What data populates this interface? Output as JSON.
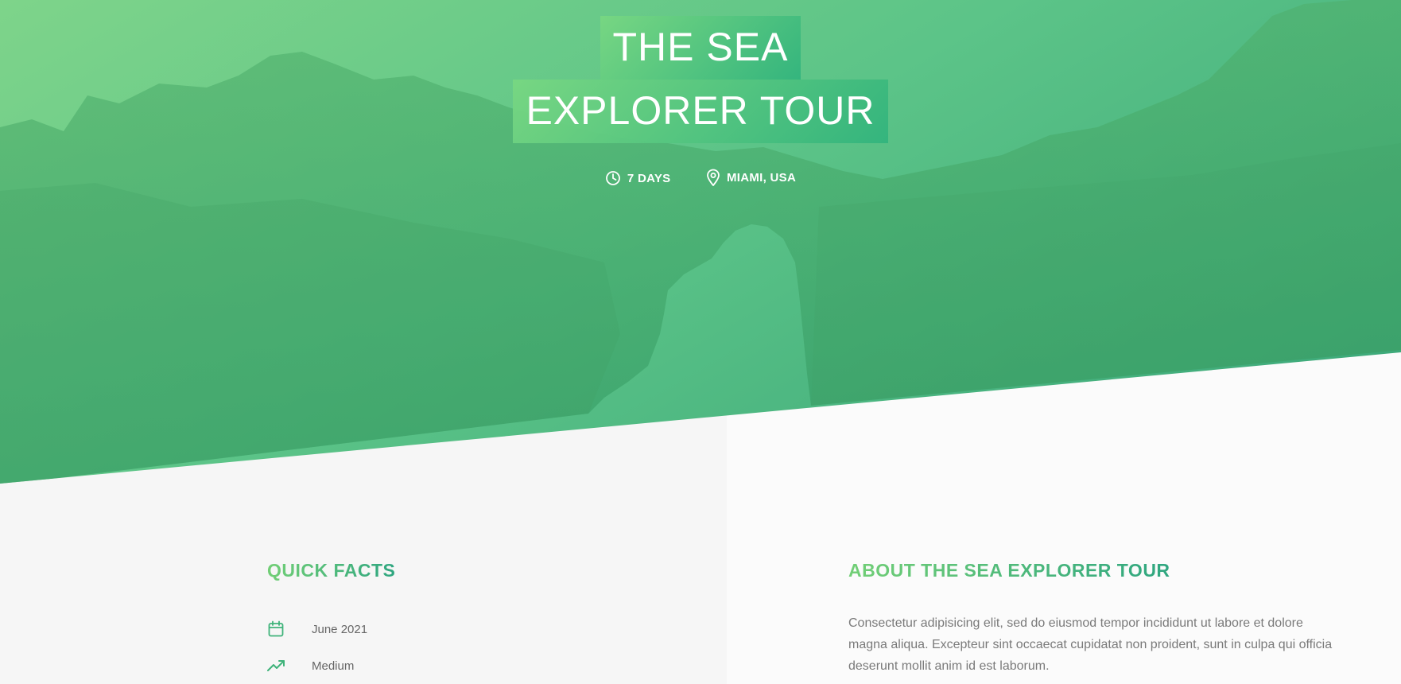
{
  "hero": {
    "title_line1": "THE SEA",
    "title_line2": "EXPLORER TOUR",
    "duration": "7 DAYS",
    "location": "MIAMI, USA"
  },
  "quick_facts": {
    "heading": "QUICK FACTS",
    "items": [
      {
        "icon": "calendar-icon",
        "text": "June 2021"
      },
      {
        "icon": "trending-up-icon",
        "text": "Medium"
      }
    ]
  },
  "about": {
    "heading": "ABOUT THE SEA EXPLORER TOUR",
    "body": "Consectetur adipisicing elit, sed do eiusmod tempor incididunt ut labore et dolore magna aliqua. Excepteur sint occaecat cupidatat non proident, sunt in culpa qui officia deserunt mollit anim id est laborum."
  },
  "colors": {
    "accent_start": "#72cf76",
    "accent_end": "#2fa680",
    "hero_overlay": "#5cc488"
  }
}
